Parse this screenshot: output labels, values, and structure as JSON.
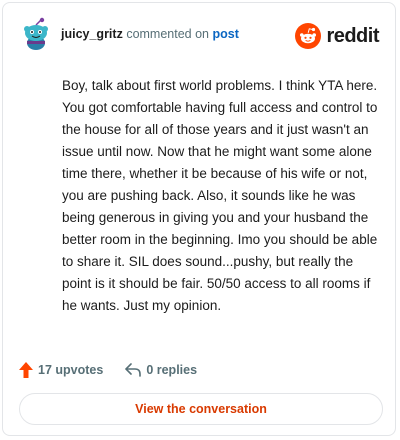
{
  "header": {
    "username": "juicy_gritz",
    "verb": "commented on",
    "post_link": "post",
    "brand": "reddit"
  },
  "comment": {
    "text": "Boy, talk about first world problems. I think YTA here. You got comfortable having full access and control to the house for all of those years and it just wasn't an issue until now. Now that he might want some alone time there, whether it be because of his wife or not, you are pushing back. Also, it sounds like he was being generous in giving you and your husband the better room in the beginning. Imo you should be able to share it. SIL does sound...pushy, but really the point is it should be fair. 50/50 access to all rooms if he wants. Just my opinion."
  },
  "actions": {
    "upvotes": "17 upvotes",
    "replies": "0 replies"
  },
  "cta": {
    "label": "View the conversation"
  },
  "colors": {
    "accent": "#ff4500",
    "link": "#0a66c2",
    "cta_text": "#d93a00",
    "muted": "#576f76"
  },
  "icons": {
    "avatar": "snoo-avatar-icon",
    "brand": "reddit-logo-icon",
    "upvote": "upvote-arrow-icon",
    "reply": "reply-arrow-icon"
  }
}
